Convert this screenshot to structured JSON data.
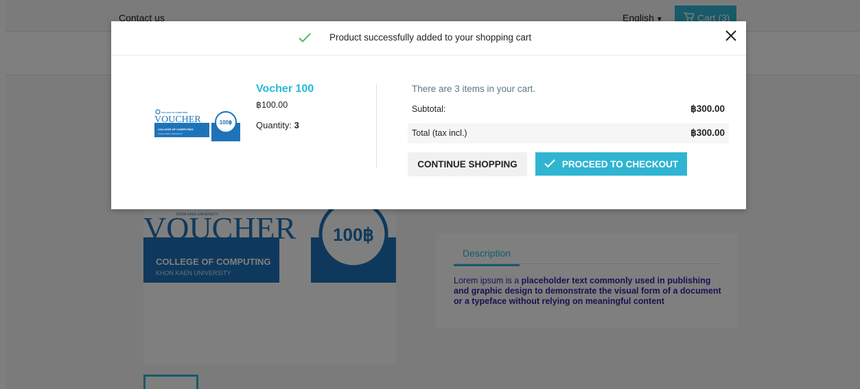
{
  "header": {
    "contact_label": "Contact us",
    "language": "English",
    "cart_label": "Cart (3)"
  },
  "product_page": {
    "voucher_image": {
      "college_mark": "COMPUTING",
      "university_mark": "KHON KAEN UNIVERSITY",
      "title": "VOUCHER",
      "subtitle": "COLLEGE OF COMPUTING",
      "caption": "KHON KAEN UNIVERSITY",
      "value_badge": "100฿"
    },
    "tab_description_label": "Description",
    "description": {
      "part1": "Lorem ipsum is a ",
      "part2": "placeholder text commonly used in publishing and graphic design to demonstrate the visual form of a document or a typeface without relying on meaningful content"
    }
  },
  "modal": {
    "title": "Product successfully added to your shopping cart",
    "product": {
      "name": "Vocher 100",
      "price": "฿100.00",
      "quantity_label": "Quantity:",
      "quantity_value": "3",
      "image": {
        "college_mark": "COLLEGE OF COMPUTING",
        "title": "VOUCHER",
        "subtitle": "COLLEGE OF COMPUTING",
        "caption": "KHON KAEN UNIVERSITY",
        "value_badge": "100฿"
      }
    },
    "cart_summary": {
      "count_text": "There are 3 items in your cart.",
      "subtotal_label": "Subtotal:",
      "subtotal_value": "฿300.00",
      "total_label": "Total (tax incl.)",
      "total_value": "฿300.00"
    },
    "buttons": {
      "continue": "CONTINUE SHOPPING",
      "checkout": "PROCEED TO CHECKOUT"
    }
  },
  "colors": {
    "accent": "#2fb5d2",
    "link": "#24b9d7",
    "success": "#4cbb6c",
    "voucher_blue": "#1e73b8"
  },
  "icons": [
    "cart-icon",
    "caret-down-icon",
    "success-check-icon",
    "close-icon",
    "check-icon"
  ]
}
